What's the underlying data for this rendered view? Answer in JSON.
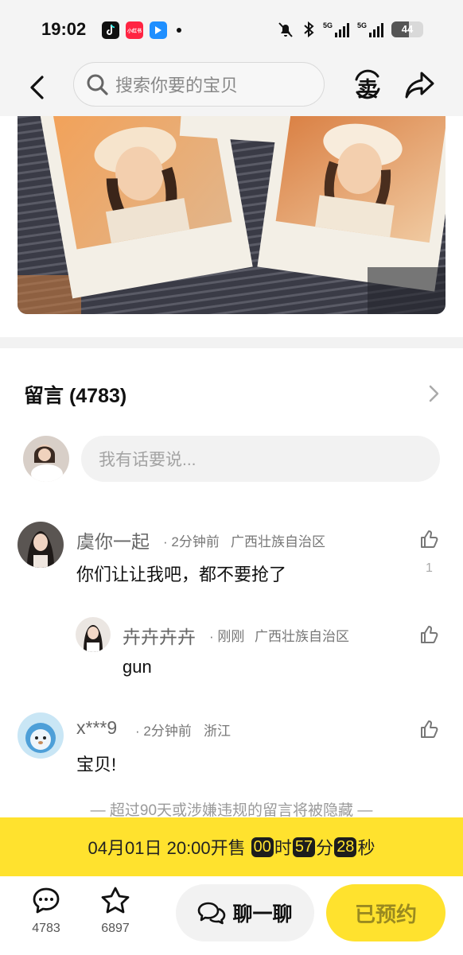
{
  "status_bar": {
    "time": "19:02",
    "app_badge": "小红书",
    "signal_1": "5G",
    "signal_2": "5G",
    "battery": "44"
  },
  "nav": {
    "search_placeholder": "搜索你要的宝贝",
    "sell_label": "卖"
  },
  "comments": {
    "title": "留言 (4783)",
    "input_placeholder": "我有话要说...",
    "items": [
      {
        "name": "虞你一起",
        "time": "· 2分钟前",
        "region": "广西壮族自治区",
        "text": "你们让让我吧，都不要抢了",
        "likes": "1"
      },
      {
        "name": "卉卉卉卉",
        "time": "· 刚刚",
        "region": "广西壮族自治区",
        "text": "gun"
      },
      {
        "name": "x***9",
        "time": "· 2分钟前",
        "region": "浙江",
        "text": "宝贝!"
      }
    ],
    "notice": "— 超过90天或涉嫌违规的留言将被隐藏 —"
  },
  "sale_banner": {
    "prefix": "04月01日 20:00开售",
    "hours": "00",
    "hours_unit": "时",
    "minutes": "57",
    "minutes_unit": "分",
    "seconds": "28",
    "seconds_unit": "秒"
  },
  "bottom_bar": {
    "comment_count": "4783",
    "favorite_count": "6897",
    "chat_label": "聊一聊",
    "booked_label": "已预约"
  },
  "colors": {
    "accent_yellow": "#ffe22e",
    "background": "#ffffff",
    "muted_text": "#666666"
  }
}
